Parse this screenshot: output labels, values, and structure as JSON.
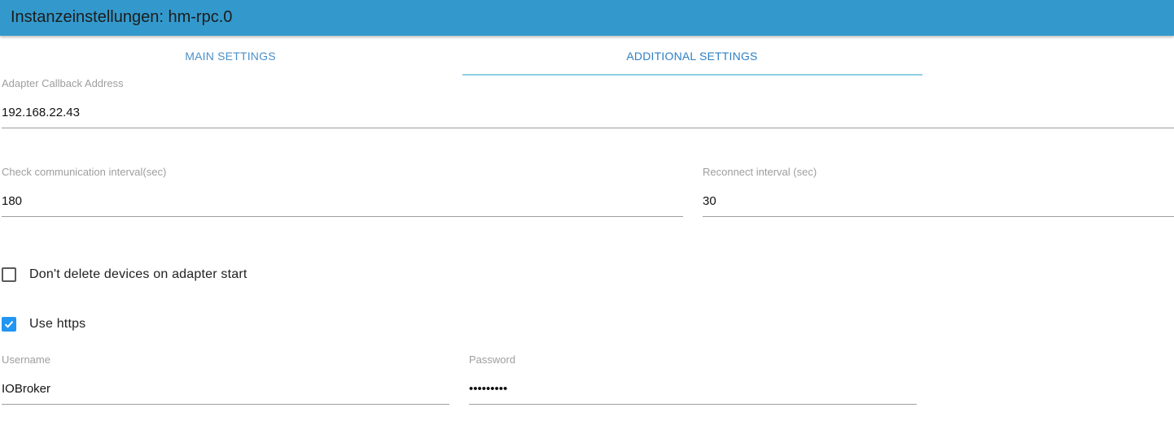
{
  "window": {
    "title": "Instanzeinstellungen: hm-rpc.0"
  },
  "tabs": [
    {
      "label": "MAIN SETTINGS",
      "active": false
    },
    {
      "label": "ADDITIONAL SETTINGS",
      "active": true
    }
  ],
  "fields": {
    "callback_address": {
      "label": "Adapter Callback Address",
      "value": "192.168.22.43"
    },
    "check_interval": {
      "label": "Check communication interval(sec)",
      "value": "180"
    },
    "reconnect_interval": {
      "label": "Reconnect interval (sec)",
      "value": "30"
    },
    "username": {
      "label": "Username",
      "value": "IOBroker"
    },
    "password": {
      "label": "Password",
      "value": "•••••••••"
    }
  },
  "checkboxes": {
    "dont_delete_devices": {
      "label": "Don't delete devices on adapter start",
      "checked": false
    },
    "use_https": {
      "label": "Use https",
      "checked": true
    }
  },
  "colors": {
    "header": "#3399cc",
    "accent": "#2196f3",
    "tab_indicator": "#8fcfe2"
  }
}
